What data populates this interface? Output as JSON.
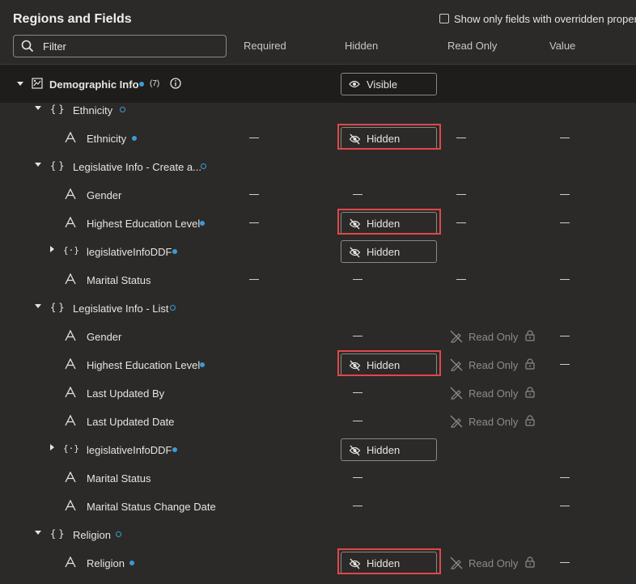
{
  "title": "Regions and Fields",
  "override_checkbox_label": "Show only fields with overridden properties",
  "filter": {
    "placeholder": "Filter"
  },
  "columns": {
    "required": "Required",
    "hidden": "Hidden",
    "read_only": "Read Only",
    "value": "Value"
  },
  "colors": {
    "highlight_border": "#e0474a",
    "indicator_dot": "#3c9bd4"
  },
  "demographic": {
    "label": "Demographic Info",
    "count": "(7)",
    "visibility": "Visible"
  },
  "ethnicity_group": {
    "label": "Ethnicity"
  },
  "ethnicity_field": {
    "label": "Ethnicity",
    "hidden": "Hidden"
  },
  "leg_create_group": {
    "label": "Legislative Info - Create a..."
  },
  "leg_create_gender": {
    "label": "Gender"
  },
  "leg_create_education": {
    "label": "Highest Education Level",
    "hidden": "Hidden"
  },
  "leg_create_ddf": {
    "label": "legislativeInfoDDF",
    "hidden": "Hidden"
  },
  "leg_create_marital": {
    "label": "Marital Status"
  },
  "leg_list_group": {
    "label": "Legislative Info - List"
  },
  "leg_list_gender": {
    "label": "Gender",
    "read_only": "Read Only"
  },
  "leg_list_education": {
    "label": "Highest Education Level",
    "hidden": "Hidden",
    "read_only": "Read Only"
  },
  "leg_list_updated_by": {
    "label": "Last Updated By",
    "read_only": "Read Only"
  },
  "leg_list_updated_date": {
    "label": "Last Updated Date",
    "read_only": "Read Only"
  },
  "leg_list_ddf": {
    "label": "legislativeInfoDDF",
    "hidden": "Hidden"
  },
  "leg_list_marital": {
    "label": "Marital Status"
  },
  "leg_list_marital_change": {
    "label": "Marital Status Change Date"
  },
  "religion_group": {
    "label": "Religion"
  },
  "religion_field": {
    "label": "Religion",
    "hidden": "Hidden",
    "read_only": "Read Only"
  }
}
